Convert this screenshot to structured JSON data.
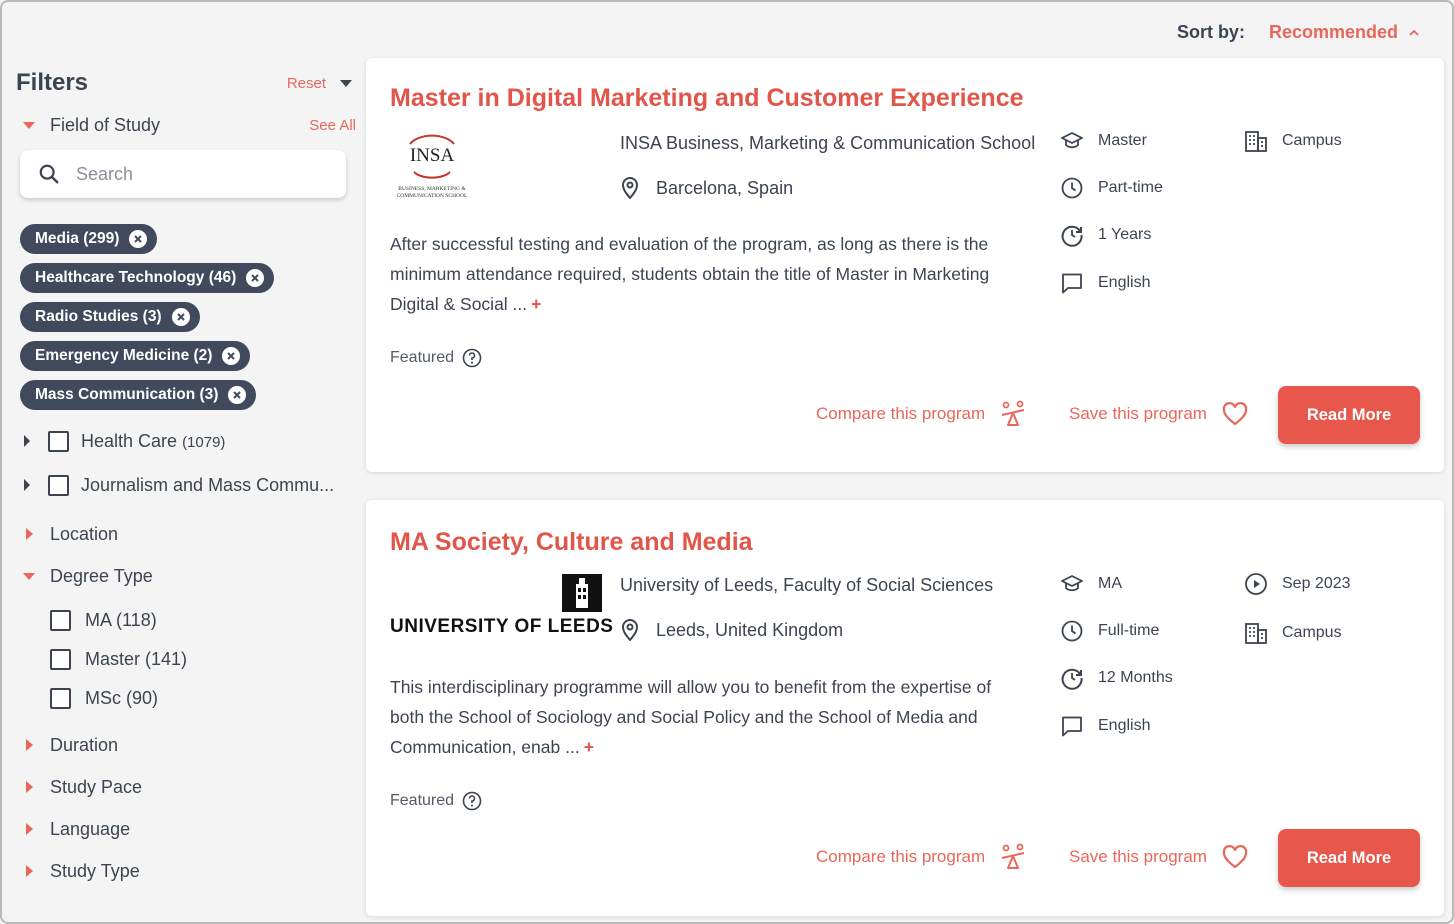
{
  "sort": {
    "label": "Sort by:",
    "value": "Recommended"
  },
  "filters": {
    "title": "Filters",
    "reset": "Reset",
    "field_of_study": {
      "label": "Field of Study",
      "see_all": "See All",
      "search_placeholder": "Search",
      "chips": [
        "Media (299)",
        "Healthcare Technology (46)",
        "Radio Studies (3)",
        "Emergency Medicine (2)",
        "Mass Communication (3)"
      ],
      "subitems": [
        {
          "label": "Health Care",
          "count": "(1079)"
        },
        {
          "label": "Journalism and Mass Commu...",
          "count": ""
        }
      ]
    },
    "location": "Location",
    "degree_type": {
      "label": "Degree Type",
      "options": [
        "MA (118)",
        "Master (141)",
        "MSc (90)"
      ]
    },
    "duration": "Duration",
    "study_pace": "Study Pace",
    "language": "Language",
    "study_type": "Study Type"
  },
  "cards": [
    {
      "title": "Master in Digital Marketing and Customer Experience",
      "logo_text": "INSA",
      "logo_sub": "BUSINESS, MARKETING & COMMUNICATION SCHOOL",
      "school": "INSA Business, Marketing & Communication School",
      "location": "Barcelona, Spain",
      "description": "After successful testing and evaluation of the program, as long as there is the minimum attendance required, students obtain the title of Master in Marketing Digital & Social ...",
      "featured": "Featured",
      "degree": "Master",
      "pace": "Part-time",
      "duration": "1 Years",
      "language": "English",
      "format": "Campus",
      "compare": "Compare this program",
      "save": "Save this program",
      "read_more": "Read More"
    },
    {
      "title": "MA Society, Culture and Media",
      "logo_text": "UNIVERSITY OF LEEDS",
      "school": "University of Leeds, Faculty of Social Sciences",
      "location": "Leeds, United Kingdom",
      "description": "This interdisciplinary programme will allow you to benefit from the expertise of both the School of Sociology and Social Policy and the School of Media and Communication, enab ...",
      "featured": "Featured",
      "degree": "MA",
      "pace": "Full-time",
      "duration": "12 Months",
      "language": "English",
      "start": "Sep 2023",
      "format": "Campus",
      "compare": "Compare this program",
      "save": "Save this program",
      "read_more": "Read More"
    }
  ],
  "colors": {
    "accent": "#e8675a",
    "title": "#e2554a",
    "chip": "#414a5c",
    "text": "#3d4451"
  }
}
